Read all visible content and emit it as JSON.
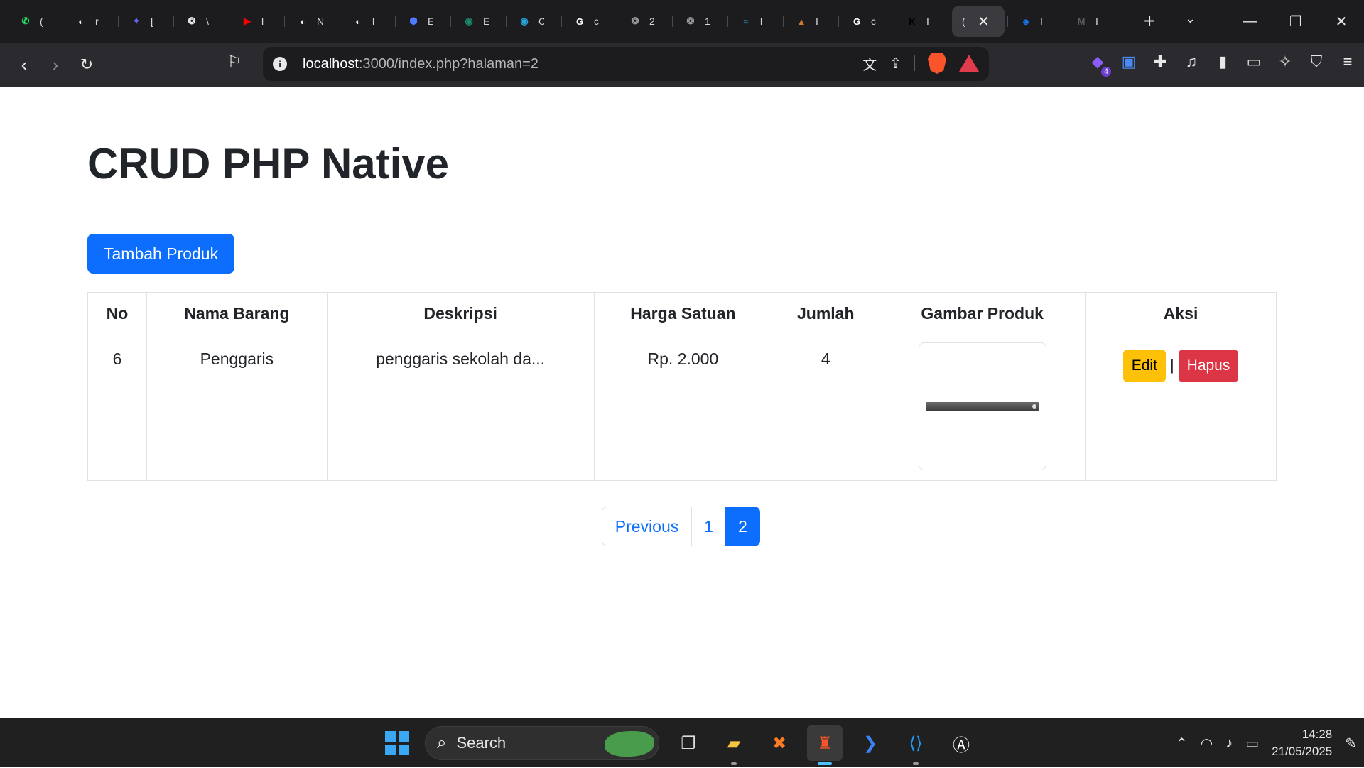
{
  "browser": {
    "tabs": [
      {
        "title": "(",
        "icon": "whatsapp-icon",
        "color": "#25d366",
        "glyph": "✆"
      },
      {
        "title": "r",
        "icon": "github-icon",
        "color": "#f0f0f0",
        "glyph": "◐"
      },
      {
        "title": "[",
        "icon": "codeium-icon",
        "color": "#6366f1",
        "glyph": "✦"
      },
      {
        "title": "\\",
        "icon": "chatgpt-icon",
        "color": "#e8e8ea",
        "glyph": "❂"
      },
      {
        "title": "l",
        "icon": "youtube-icon",
        "color": "#ff0000",
        "glyph": "▶"
      },
      {
        "title": "N",
        "icon": "github-icon",
        "color": "#f0f0f0",
        "glyph": "◐"
      },
      {
        "title": "l",
        "icon": "github-icon",
        "color": "#f0f0f0",
        "glyph": "◐"
      },
      {
        "title": "E",
        "icon": "app-icon",
        "color": "#4d7cfe",
        "glyph": "⬢"
      },
      {
        "title": "E",
        "icon": "globe-icon",
        "color": "#1e8a6e",
        "glyph": "◉"
      },
      {
        "title": "C",
        "icon": "app-icon",
        "color": "#29a8e0",
        "glyph": "◉"
      },
      {
        "title": "c",
        "icon": "google-icon",
        "color": "#ffffff",
        "glyph": "G"
      },
      {
        "title": "2",
        "icon": "chatgpt-icon",
        "color": "#9a9aa0",
        "glyph": "❂"
      },
      {
        "title": "1",
        "icon": "chatgpt-icon",
        "color": "#9a9aa0",
        "glyph": "❂"
      },
      {
        "title": "l",
        "icon": "app-icon",
        "color": "#3aa3e3",
        "glyph": "≈"
      },
      {
        "title": "I",
        "icon": "app-icon",
        "color": "#d07b2b",
        "glyph": "▲"
      },
      {
        "title": "c",
        "icon": "google-icon",
        "color": "#ffffff",
        "glyph": "G"
      },
      {
        "title": "I",
        "icon": "app-icon",
        "color": "#000000",
        "glyph": "K"
      },
      {
        "title": "(",
        "icon": "app-icon",
        "color": "#3b3b3f",
        "glyph": "",
        "active": true
      },
      {
        "title": "I",
        "icon": "contact-icon",
        "color": "#1a73e8",
        "glyph": "☻"
      },
      {
        "title": "I",
        "icon": "app-icon",
        "color": "#5a5a5f",
        "glyph": "M"
      }
    ],
    "url_host": "localhost",
    "url_rest": ":3000/index.php?halaman=2",
    "ext_badge": "4"
  },
  "page": {
    "title": "CRUD PHP Native",
    "add_button": "Tambah Produk",
    "table": {
      "headers": [
        "No",
        "Nama Barang",
        "Deskripsi",
        "Harga Satuan",
        "Jumlah",
        "Gambar Produk",
        "Aksi"
      ],
      "rows": [
        {
          "no": "6",
          "nama": "Penggaris",
          "deskripsi": "penggaris sekolah da...",
          "harga": "Rp. 2.000",
          "jumlah": "4",
          "gambar": "ruler-image",
          "edit": "Edit",
          "separator": "|",
          "hapus": "Hapus"
        }
      ]
    },
    "pagination": {
      "previous": "Previous",
      "pages": [
        "1",
        "2"
      ],
      "current": "2"
    }
  },
  "taskbar": {
    "search": "Search",
    "time": "14:28",
    "date": "21/05/2025",
    "accent": "#4cc2ff"
  }
}
